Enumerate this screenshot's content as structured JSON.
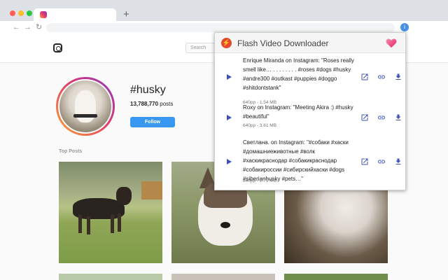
{
  "browser": {
    "tab_title": "",
    "new_tab_symbol": "+",
    "nav": {
      "back": "←",
      "forward": "→",
      "reload": "↻"
    },
    "extension_icon": "i"
  },
  "instagram": {
    "search_placeholder": "Search",
    "hashtag": "#husky",
    "posts_count": "13,788,770",
    "posts_label": " posts",
    "follow_label": "Follow",
    "top_posts_label": "Top Posts"
  },
  "popup": {
    "title": "Flash Video Downloader",
    "logo_symbol": "⚡",
    "accent_color": "#3f51b5",
    "items": [
      {
        "title": "Enrique Miranda on Instagram: \"Roses really smell like… . . . . . . . . #roses #dogs #husky #andre300 #outkast #puppies #doggo #shitdontstank\"",
        "meta": "640pp - 1.54 MB"
      },
      {
        "title": "Roxy on Instagram: \"Meeting Akira :) #husky #beautiful\"",
        "meta": "640pp - 3.61 MB"
      },
      {
        "title": "Светлана. on Instagram: \"#собаки #хаски #домашниеживотные #волк #хаскикраснодар #собакикраснодар #собакироссии #сибирскийхаски #dogs #siberianhusky #pets…\"",
        "meta": "640pp - 2.79 MB"
      }
    ]
  }
}
